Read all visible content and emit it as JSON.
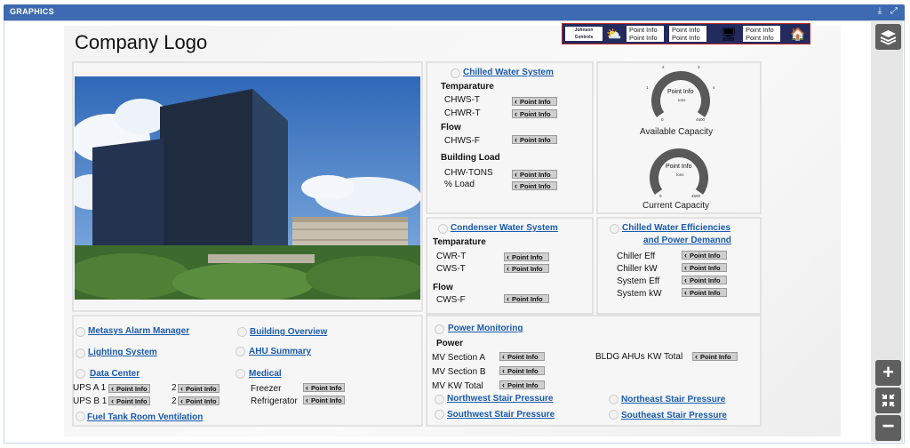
{
  "window": {
    "title": "GRAPHICS",
    "download_icon": "download-icon",
    "expand_icon": "expand-icon"
  },
  "header": {
    "logo_text": "Company Logo",
    "brand": {
      "name_line1": "Johnson",
      "name_line2": "Controls"
    },
    "weather_point": {
      "line1": "Point Info",
      "line2": "Point Info"
    },
    "mid_point": {
      "line1": "Point Info",
      "line2": "Point Info"
    },
    "right_point": {
      "line1": "Point Info",
      "line2": "Point Info"
    },
    "icons": [
      "weather-icon",
      "devices-icon",
      "home-icon"
    ]
  },
  "point_label": "Point Info",
  "chilled_water": {
    "title": "Chilled Water System",
    "temperature_header": "Temparature",
    "chws_t": "CHWS-T",
    "chwr_t": "CHWR-T",
    "flow_header": "Flow",
    "chws_f": "CHWS-F",
    "load_header": "Building Load",
    "chw_tons": "CHW-TONS",
    "pct_load": "% Load"
  },
  "gauges": {
    "available": {
      "caption": "Available Capacity",
      "center_label": "Point Info",
      "unit": "tons",
      "min": "0",
      "max": "4500",
      "ticks": [
        "1",
        "2",
        "3",
        "4"
      ],
      "accent": "#5a5a5a"
    },
    "current": {
      "caption": "Current Capacity",
      "center_label": "Point Info",
      "unit": "tons",
      "min": "0",
      "max": "4500"
    }
  },
  "condenser_water": {
    "title": "Condenser Water System",
    "temperature_header": "Temparature",
    "cwr_t": "CWR-T",
    "cws_t": "CWS-T",
    "flow_header": "Flow",
    "cws_f": "CWS-F"
  },
  "efficiencies": {
    "title_line1": "Chilled Water Efficiencies",
    "title_line2": "and Power Demannd",
    "chiller_eff": "Chiller Eff",
    "chiller_kw": "Chiller kW",
    "system_eff": "System Eff",
    "system_kw": "System kW"
  },
  "nav_links": {
    "alarm_manager": "Metasys Alarm Manager",
    "building_overview": "Building Overview",
    "lighting": "Lighting System",
    "ahu_summary": "AHU Summary",
    "data_center": "Data Center",
    "medical": "Medical",
    "fuel_tank": "Fuel Tank Room Ventilation"
  },
  "data_center": {
    "ups_a1": "UPS A 1",
    "ups_b1": "UPS B 1",
    "col2_a": "2",
    "col2_b": "2"
  },
  "medical": {
    "freezer": "Freezer",
    "refrigerator": "Refrigerator"
  },
  "power": {
    "title": "Power Monitoring",
    "header": "Power",
    "mv_a": "MV Section A",
    "mv_b": "MV Section B",
    "mv_kw": "MV KW Total",
    "bldg_ahus": "BLDG AHUs KW Total"
  },
  "stairs": {
    "nw": "Northwest Stair Pressure",
    "sw": "Southwest Stair Pressure",
    "ne": "Northeast Stair Pressure",
    "se": "Southeast Stair Pressure"
  },
  "sidebar_tools": [
    "layers-icon",
    "zoom-in-icon",
    "fit-icon",
    "zoom-out-icon"
  ],
  "colors": {
    "titlebar": "#3d6ab0",
    "link": "#1a5aab",
    "brand_bar": "#232a5e"
  }
}
